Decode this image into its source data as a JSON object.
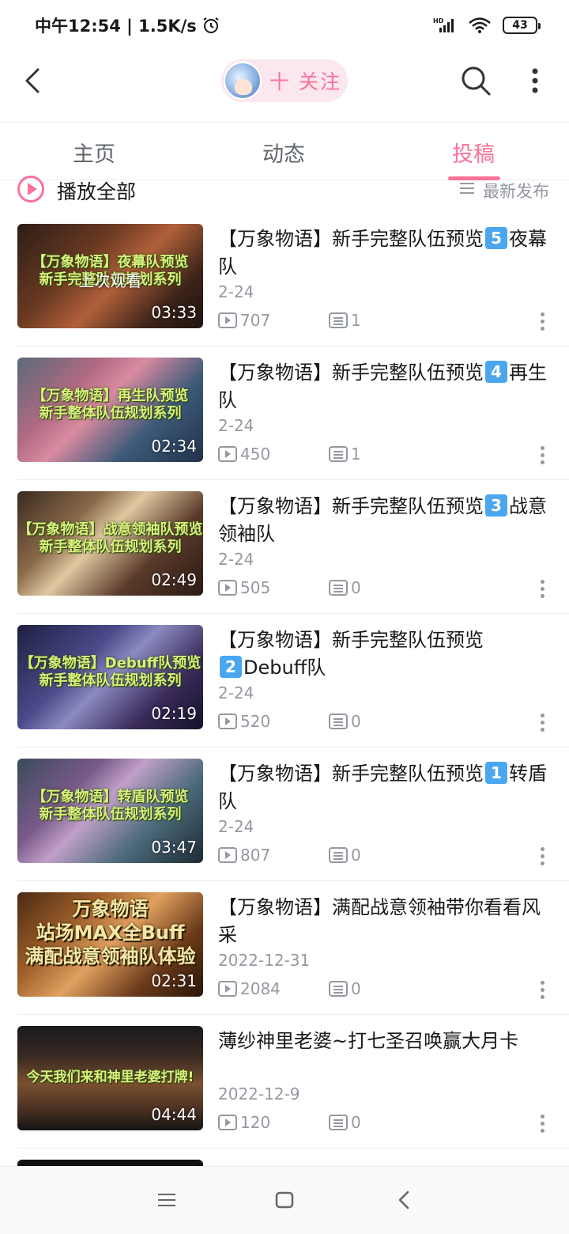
{
  "status_bar": {
    "time": "中午12:54 | 1.5K/s",
    "network": "HD",
    "battery": "43"
  },
  "header": {
    "follow_label": "十 关注"
  },
  "tabs": [
    {
      "label": "主页",
      "active": false
    },
    {
      "label": "动态",
      "active": false
    },
    {
      "label": "投稿",
      "active": true
    }
  ],
  "playall": {
    "label": "播放全部",
    "sort_label": "最新发布"
  },
  "accent_color": "#fb7299",
  "videos": [
    {
      "title_text": "【万象物语】新手完整队伍预览",
      "badge": "5",
      "title_suffix": "夜幕队",
      "date": "2-24",
      "views": "707",
      "comments": "1",
      "duration": "03:33",
      "overlay": "上次观看",
      "thumb_caption": "【万象物语】夜幕队预览\n新手完整队伍规划系列"
    },
    {
      "title_text": "【万象物语】新手完整队伍预览",
      "badge": "4",
      "title_suffix": "再生队",
      "date": "2-24",
      "views": "450",
      "comments": "1",
      "duration": "02:34",
      "overlay": "",
      "thumb_caption": "【万象物语】再生队预览\n新手整体队伍规划系列"
    },
    {
      "title_text": "【万象物语】新手完整队伍预览",
      "badge": "3",
      "title_suffix": "战意领袖队",
      "date": "2-24",
      "views": "505",
      "comments": "0",
      "duration": "02:49",
      "overlay": "",
      "thumb_caption": "【万象物语】战意领袖队预览\n新手整体队伍规划系列"
    },
    {
      "title_text": "【万象物语】新手完整队伍预览",
      "badge": "2",
      "title_suffix": "Debuff队",
      "date": "2-24",
      "views": "520",
      "comments": "0",
      "duration": "02:19",
      "overlay": "",
      "thumb_caption": "【万象物语】Debuff队预览\n新手整体队伍规划系列"
    },
    {
      "title_text": "【万象物语】新手完整队伍预览",
      "badge": "1",
      "title_suffix": "转盾队",
      "date": "2-24",
      "views": "807",
      "comments": "0",
      "duration": "03:47",
      "overlay": "",
      "thumb_caption": "【万象物语】转盾队预览\n新手整体队伍规划系列"
    },
    {
      "title_text": "【万象物语】满配战意领袖带你看看风采",
      "badge": "",
      "title_suffix": "",
      "date": "2022-12-31",
      "views": "2084",
      "comments": "0",
      "duration": "02:31",
      "overlay": "",
      "thumb_caption": "万象物语\n站场MAX全Buff\n满配战意领袖队体验"
    },
    {
      "title_text": "薄纱神里老婆~打七圣召唤赢大月卡",
      "badge": "",
      "title_suffix": "",
      "date": "2022-12-9",
      "views": "120",
      "comments": "0",
      "duration": "04:44",
      "overlay": "",
      "thumb_caption": "今天我们来和神里老婆打牌!"
    }
  ]
}
